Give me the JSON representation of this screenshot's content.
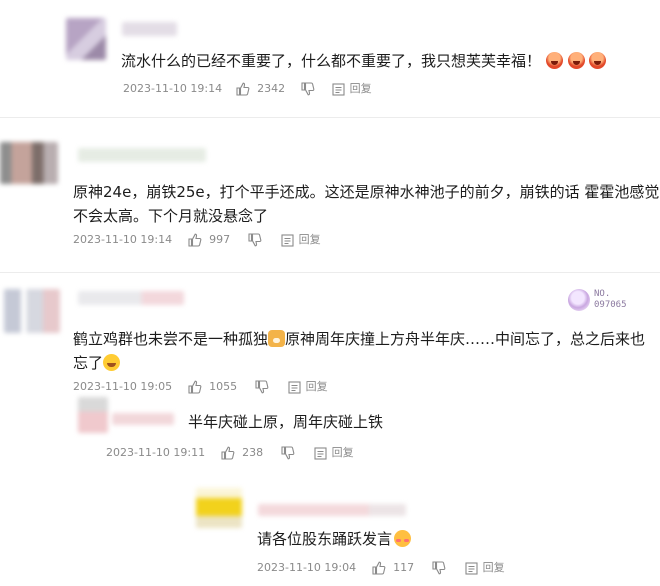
{
  "comments": [
    {
      "text_lines": [
        "流水什么的已经不重要了，什么都不重要了，我只想芙芙幸福！"
      ],
      "emojis": [
        "crying-face-icon",
        "crying-face-icon",
        "crying-face-icon"
      ],
      "time": "2023-11-10 19:14",
      "likes": "2342",
      "reply_label": "回复"
    },
    {
      "text_lines": [
        "原神24e，崩铁25e，打个平手还成。这还是原神水神池子的前夕，崩铁的话 霍霍池感觉",
        "不会太高。下个月就没悬念了"
      ],
      "time": "2023-11-10 19:14",
      "likes": "997",
      "reply_label": "回复"
    },
    {
      "text_part1": "鹤立鸡群也未尝不是一种孤独",
      "text_part2": "原神周年庆撞上方舟半年庆……中间忘了，总之后来也",
      "text_line2": "忘了",
      "time": "2023-11-10 19:05",
      "likes": "1055",
      "reply_label": "回复"
    },
    {
      "text_lines": [
        "半年庆碰上原，周年庆碰上铁"
      ],
      "time": "2023-11-10 19:11",
      "likes": "238",
      "reply_label": "回复"
    },
    {
      "text_lines": [
        "请各位股东踊跃发言"
      ],
      "time": "2023-11-10 19:04",
      "likes": "117",
      "reply_label": "回复"
    }
  ],
  "watermark": {
    "line1": "NO.",
    "line2": "097065"
  },
  "colors": {
    "text": "#1c1c1c",
    "meta": "#8a8a8a",
    "divider": "#ececec"
  }
}
